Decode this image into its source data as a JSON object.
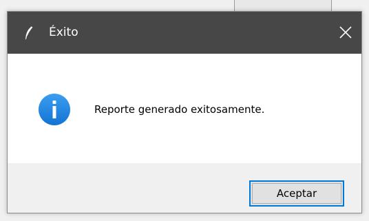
{
  "dialog": {
    "title": "Éxito",
    "title_icon": "feather-icon",
    "close_icon": "close-icon",
    "message": "Reporte generado exitosamente.",
    "message_icon": "info-icon",
    "ok_label": "Aceptar"
  },
  "colors": {
    "titlebar": "#474747",
    "content_bg": "#ffffff",
    "footer_bg": "#f0f0f0",
    "info_blue": "#1e88e5",
    "button_focus": "#0078d7"
  }
}
